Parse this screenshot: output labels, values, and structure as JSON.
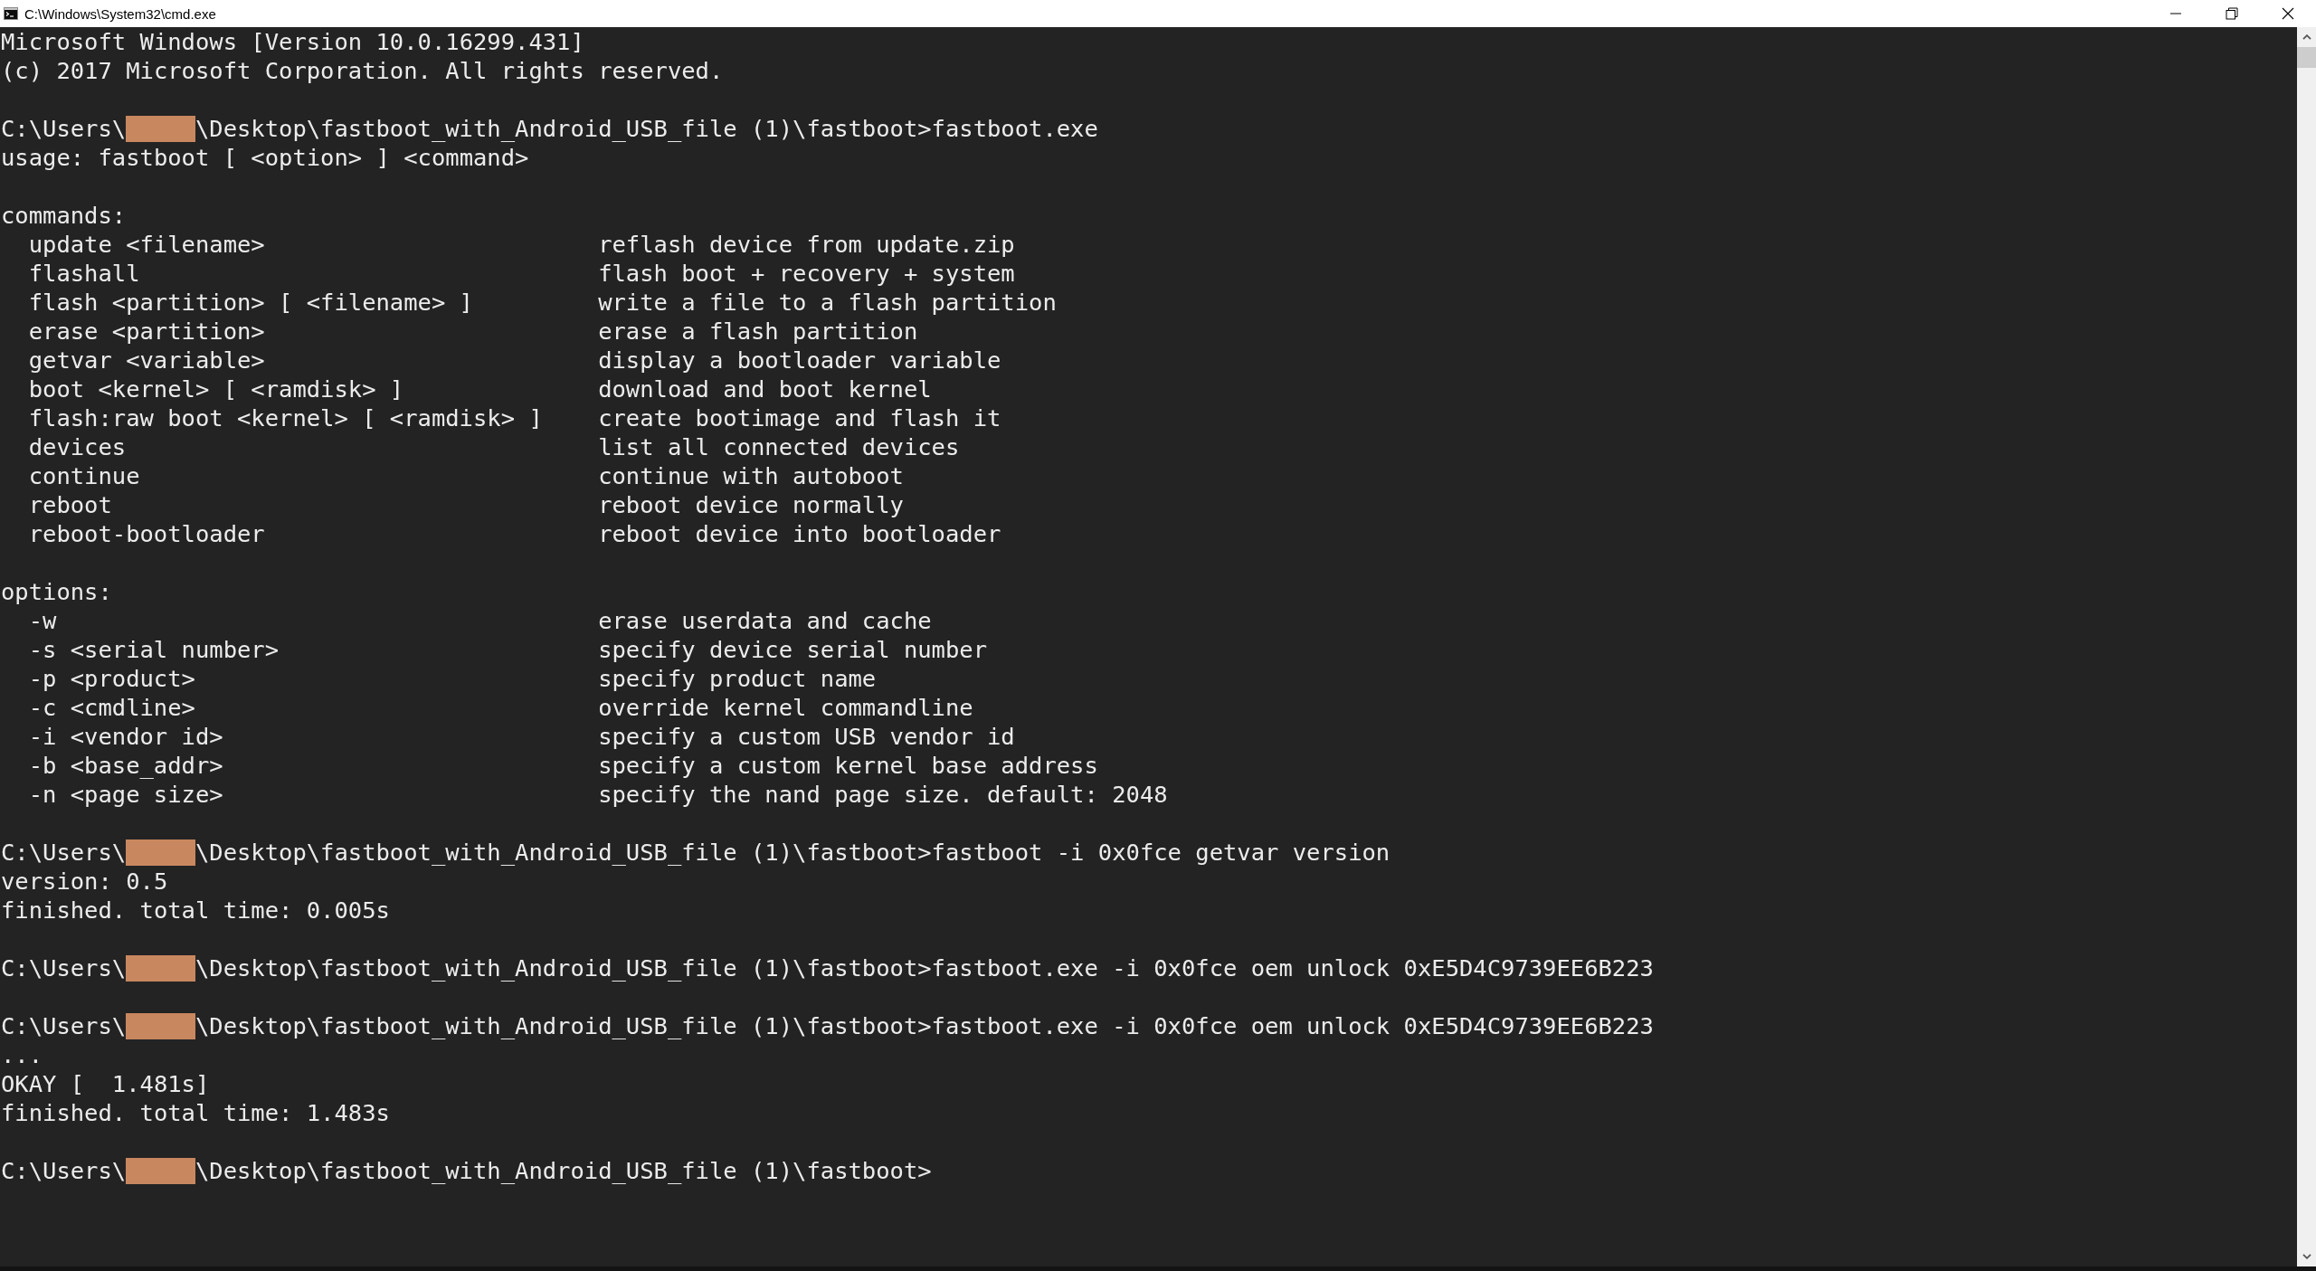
{
  "window": {
    "title": "C:\\Windows\\System32\\cmd.exe"
  },
  "console": {
    "lines": [
      {
        "kind": "text",
        "text": "Microsoft Windows [Version 10.0.16299.431]"
      },
      {
        "kind": "text",
        "text": "(c) 2017 Microsoft Corporation. All rights reserved."
      },
      {
        "kind": "blank"
      },
      {
        "kind": "prompt",
        "prefix": "C:\\Users\\",
        "suffix": "\\Desktop\\fastboot_with_Android_USB_file (1)\\fastboot>fastboot.exe"
      },
      {
        "kind": "text",
        "text": "usage: fastboot [ <option> ] <command>"
      },
      {
        "kind": "blank"
      },
      {
        "kind": "text",
        "text": "commands:"
      },
      {
        "kind": "entry",
        "term": "update <filename>",
        "description": "reflash device from update.zip"
      },
      {
        "kind": "entry",
        "term": "flashall",
        "description": "flash boot + recovery + system"
      },
      {
        "kind": "entry",
        "term": "flash <partition> [ <filename> ]",
        "description": "write a file to a flash partition"
      },
      {
        "kind": "entry",
        "term": "erase <partition>",
        "description": "erase a flash partition"
      },
      {
        "kind": "entry",
        "term": "getvar <variable>",
        "description": "display a bootloader variable"
      },
      {
        "kind": "entry",
        "term": "boot <kernel> [ <ramdisk> ]",
        "description": "download and boot kernel"
      },
      {
        "kind": "entry",
        "term": "flash:raw boot <kernel> [ <ramdisk> ]",
        "description": "create bootimage and flash it"
      },
      {
        "kind": "entry",
        "term": "devices",
        "description": "list all connected devices"
      },
      {
        "kind": "entry",
        "term": "continue",
        "description": "continue with autoboot"
      },
      {
        "kind": "entry",
        "term": "reboot",
        "description": "reboot device normally"
      },
      {
        "kind": "entry",
        "term": "reboot-bootloader",
        "description": "reboot device into bootloader"
      },
      {
        "kind": "blank"
      },
      {
        "kind": "text",
        "text": "options:"
      },
      {
        "kind": "entry",
        "term": "-w",
        "description": "erase userdata and cache"
      },
      {
        "kind": "entry",
        "term": "-s <serial number>",
        "description": "specify device serial number"
      },
      {
        "kind": "entry",
        "term": "-p <product>",
        "description": "specify product name"
      },
      {
        "kind": "entry",
        "term": "-c <cmdline>",
        "description": "override kernel commandline"
      },
      {
        "kind": "entry",
        "term": "-i <vendor id>",
        "description": "specify a custom USB vendor id"
      },
      {
        "kind": "entry",
        "term": "-b <base_addr>",
        "description": "specify a custom kernel base address"
      },
      {
        "kind": "entry",
        "term": "-n <page size>",
        "description": "specify the nand page size. default: 2048"
      },
      {
        "kind": "blank"
      },
      {
        "kind": "prompt",
        "prefix": "C:\\Users\\",
        "suffix": "\\Desktop\\fastboot_with_Android_USB_file (1)\\fastboot>fastboot -i 0x0fce getvar version"
      },
      {
        "kind": "text",
        "text": "version: 0.5"
      },
      {
        "kind": "text",
        "text": "finished. total time: 0.005s"
      },
      {
        "kind": "blank"
      },
      {
        "kind": "prompt",
        "prefix": "C:\\Users\\",
        "suffix": "\\Desktop\\fastboot_with_Android_USB_file (1)\\fastboot>fastboot.exe -i 0x0fce oem unlock 0xE5D4C9739EE6B223"
      },
      {
        "kind": "blank"
      },
      {
        "kind": "prompt",
        "prefix": "C:\\Users\\",
        "suffix": "\\Desktop\\fastboot_with_Android_USB_file (1)\\fastboot>fastboot.exe -i 0x0fce oem unlock 0xE5D4C9739EE6B223"
      },
      {
        "kind": "text",
        "text": "..."
      },
      {
        "kind": "text",
        "text": "OKAY [  1.481s]"
      },
      {
        "kind": "text",
        "text": "finished. total time: 1.483s"
      },
      {
        "kind": "blank"
      },
      {
        "kind": "prompt",
        "prefix": "C:\\Users\\",
        "suffix": "\\Desktop\\fastboot_with_Android_USB_file (1)\\fastboot>"
      }
    ]
  }
}
